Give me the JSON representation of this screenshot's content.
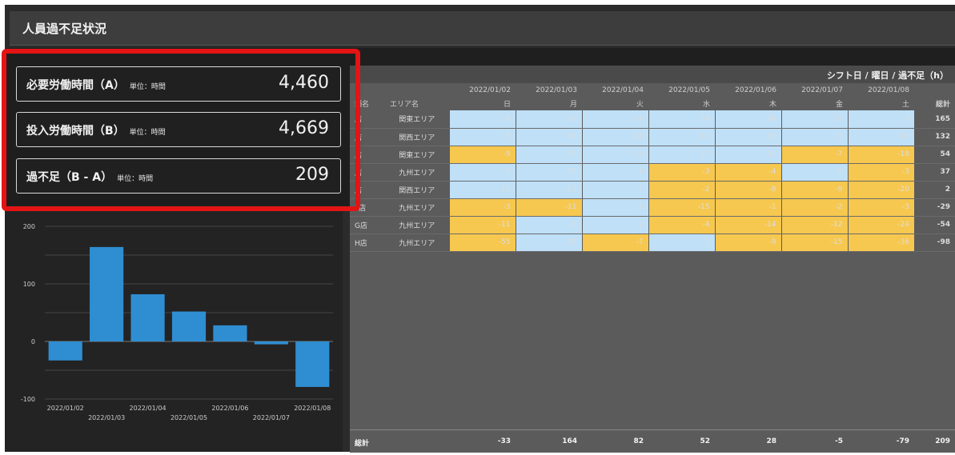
{
  "header": {
    "title": "人員過不足状況"
  },
  "kpis": [
    {
      "label": "必要労働時間（A）",
      "unit": "単位：時間",
      "value": "4,460"
    },
    {
      "label": "投入労働時間（B）",
      "unit": "単位：時間",
      "value": "4,669"
    },
    {
      "label": "過不足（B - A）",
      "unit": "単位：時間",
      "value": "209"
    }
  ],
  "chart_data": {
    "type": "bar",
    "categories": [
      "2022/01/02",
      "2022/01/03",
      "2022/01/04",
      "2022/01/05",
      "2022/01/06",
      "2022/01/07",
      "2022/01/08"
    ],
    "values": [
      -33,
      164,
      82,
      52,
      28,
      -5,
      -79
    ],
    "yticks": [
      "200",
      "100",
      "0",
      "-100"
    ],
    "ylim": [
      -100,
      200
    ],
    "grid": true,
    "bar_color": "#2f8ed2"
  },
  "table": {
    "title": "シフト日 / 曜日 / 過不足（h）",
    "dates": [
      "2022/01/02",
      "2022/01/03",
      "2022/01/04",
      "2022/01/05",
      "2022/01/06",
      "2022/01/07",
      "2022/01/08"
    ],
    "weekdays": [
      "日",
      "月",
      "火",
      "水",
      "木",
      "金",
      "土"
    ],
    "col_store": "舗名",
    "col_area": "エリア名",
    "col_total": "総計",
    "rows": [
      {
        "store": "店",
        "area": "関東エリア",
        "values": [
          19,
          30,
          29,
          34,
          24,
          21,
          9
        ],
        "total": "165"
      },
      {
        "store": "店",
        "area": "関西エリア",
        "values": [
          15,
          43,
          16,
          13,
          19,
          13,
          15
        ],
        "total": "132"
      },
      {
        "store": "店",
        "area": "関東エリア",
        "values": [
          -9,
          15,
          25,
          27,
          21,
          -7,
          -18
        ],
        "total": "54"
      },
      {
        "store": "店",
        "area": "九州エリア",
        "values": [
          2,
          35,
          6,
          -3,
          -4,
          5,
          -3
        ],
        "total": "37"
      },
      {
        "store": "店",
        "area": "関西エリア",
        "values": [
          10,
          23,
          7,
          -2,
          -8,
          -9,
          -20
        ],
        "total": "2"
      },
      {
        "store": "F店",
        "area": "九州エリア",
        "values": [
          -3,
          -11,
          5,
          -15,
          -1,
          -2,
          -3
        ],
        "total": "-29"
      },
      {
        "store": "G店",
        "area": "九州エリア",
        "values": [
          -11,
          8,
          2,
          -4,
          -14,
          -12,
          -24
        ],
        "total": "-54"
      },
      {
        "store": "H店",
        "area": "九州エリア",
        "values": [
          -55,
          22,
          -7,
          1,
          -9,
          -15,
          -36
        ],
        "total": "-98"
      }
    ],
    "footer": {
      "label": "総計",
      "values": [
        "-33",
        "164",
        "82",
        "52",
        "28",
        "-5",
        "-79"
      ],
      "total": "209"
    }
  },
  "colors": {
    "positive": "#bfe0f7",
    "negative": "#f7c84f",
    "highlight": "#e41414"
  }
}
